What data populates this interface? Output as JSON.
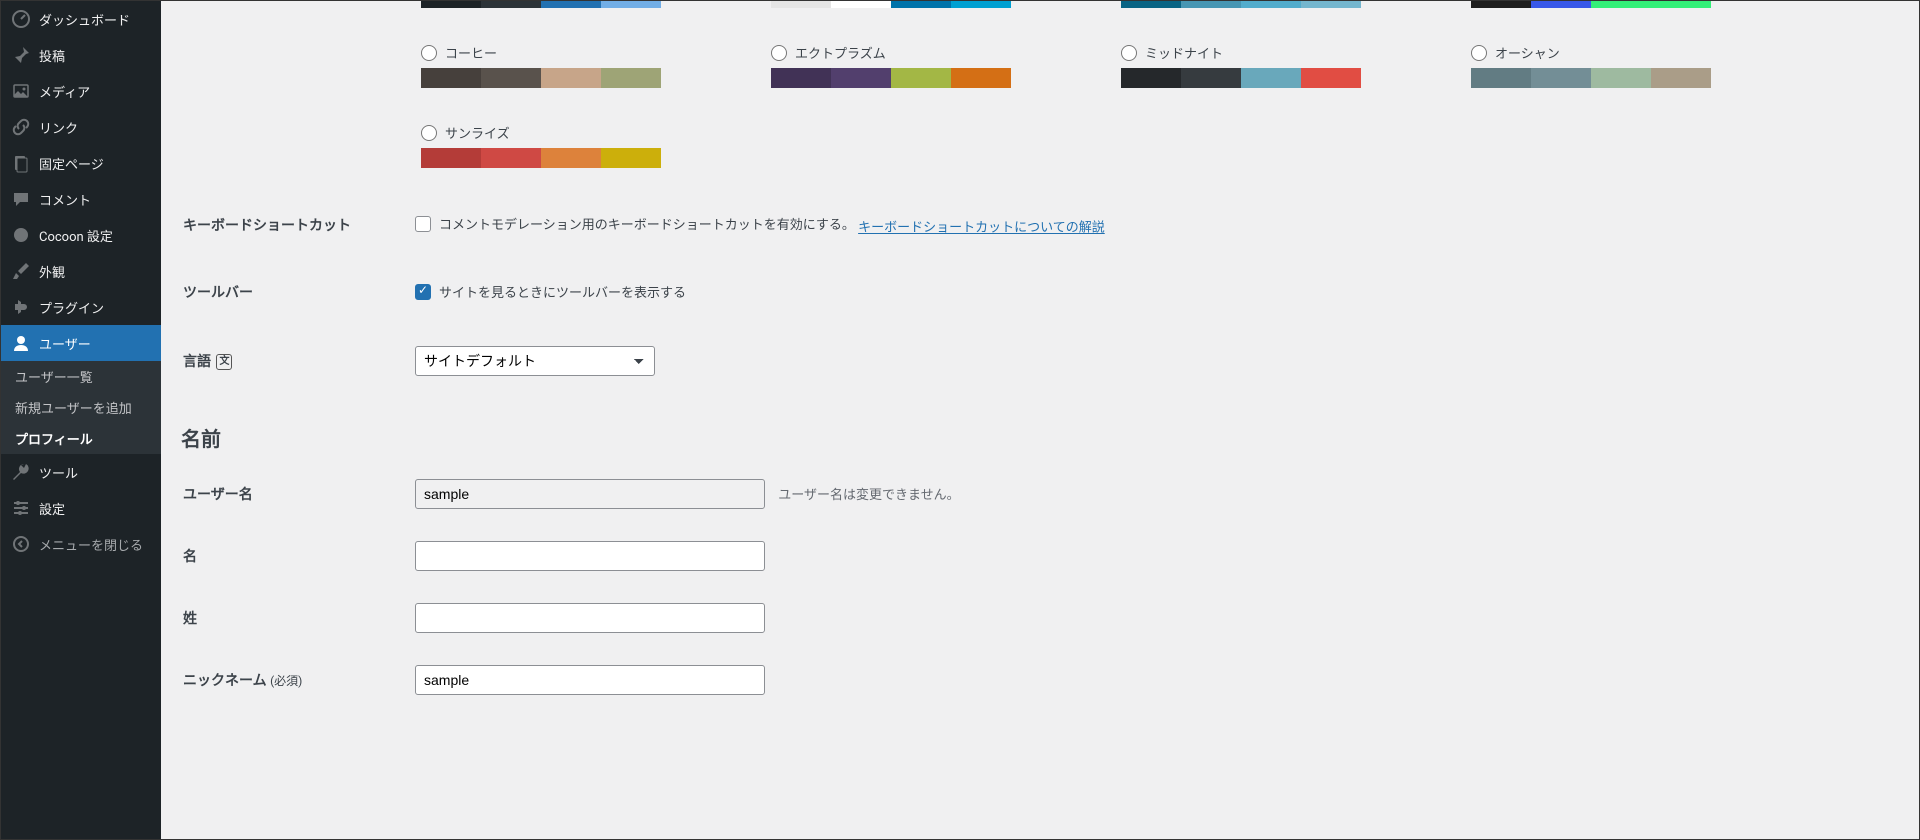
{
  "sidebar": {
    "dashboard": "ダッシュボード",
    "posts": "投稿",
    "media": "メディア",
    "links": "リンク",
    "pages": "固定ページ",
    "comments": "コメント",
    "cocoon": "Cocoon 設定",
    "appearance": "外観",
    "plugins": "プラグイン",
    "users": "ユーザー",
    "users_list": "ユーザー一覧",
    "users_add": "新規ユーザーを追加",
    "users_profile": "プロフィール",
    "tools": "ツール",
    "settings": "設定",
    "collapse": "メニューを閉じる"
  },
  "schemes": {
    "coffee": "コーヒー",
    "ectoplasm": "エクトプラズム",
    "midnight": "ミッドナイト",
    "ocean": "オーシャン",
    "sunrise": "サンライズ"
  },
  "palettes": {
    "top1": [
      "#1d2327",
      "#2c3338",
      "#2271b1",
      "#72aee6"
    ],
    "top2": [
      "#e5e5e5",
      "#ffffff",
      "#0073aa",
      "#00a0d2"
    ],
    "top3": [
      "#096484",
      "#4796b3",
      "#52accc",
      "#74b6ce"
    ],
    "top4": [
      "#e14d43",
      "#69a8bb",
      "#e14d43",
      "#e14d43"
    ],
    "coffee": [
      "#46403c",
      "#59524c",
      "#c7a589",
      "#9ea476"
    ],
    "ectoplasm": [
      "#413256",
      "#523f6d",
      "#a3b745",
      "#d46f15"
    ],
    "midnight": [
      "#25282b",
      "#363b3f",
      "#69a8bb",
      "#e14d43"
    ],
    "ocean": [
      "#627c83",
      "#738e96",
      "#9ebaa0",
      "#aa9d88"
    ],
    "sunrise": [
      "#b43c38",
      "#cf4944",
      "#dd823b",
      "#ccaf0b"
    ]
  },
  "form": {
    "keyboard_shortcuts_label": "キーボードショートカット",
    "keyboard_shortcuts_text": "コメントモデレーション用のキーボードショートカットを有効にする。",
    "keyboard_shortcuts_link": "キーボードショートカットについての解説",
    "toolbar_label": "ツールバー",
    "toolbar_text": "サイトを見るときにツールバーを表示する",
    "language_label": "言語",
    "language_value": "サイトデフォルト",
    "name_section": "名前",
    "username_label": "ユーザー名",
    "username_value": "sample",
    "username_desc": "ユーザー名は変更できません。",
    "firstname_label": "名",
    "lastname_label": "姓",
    "nickname_label": "ニックネーム",
    "nickname_required": "(必須)",
    "nickname_value": "sample"
  }
}
